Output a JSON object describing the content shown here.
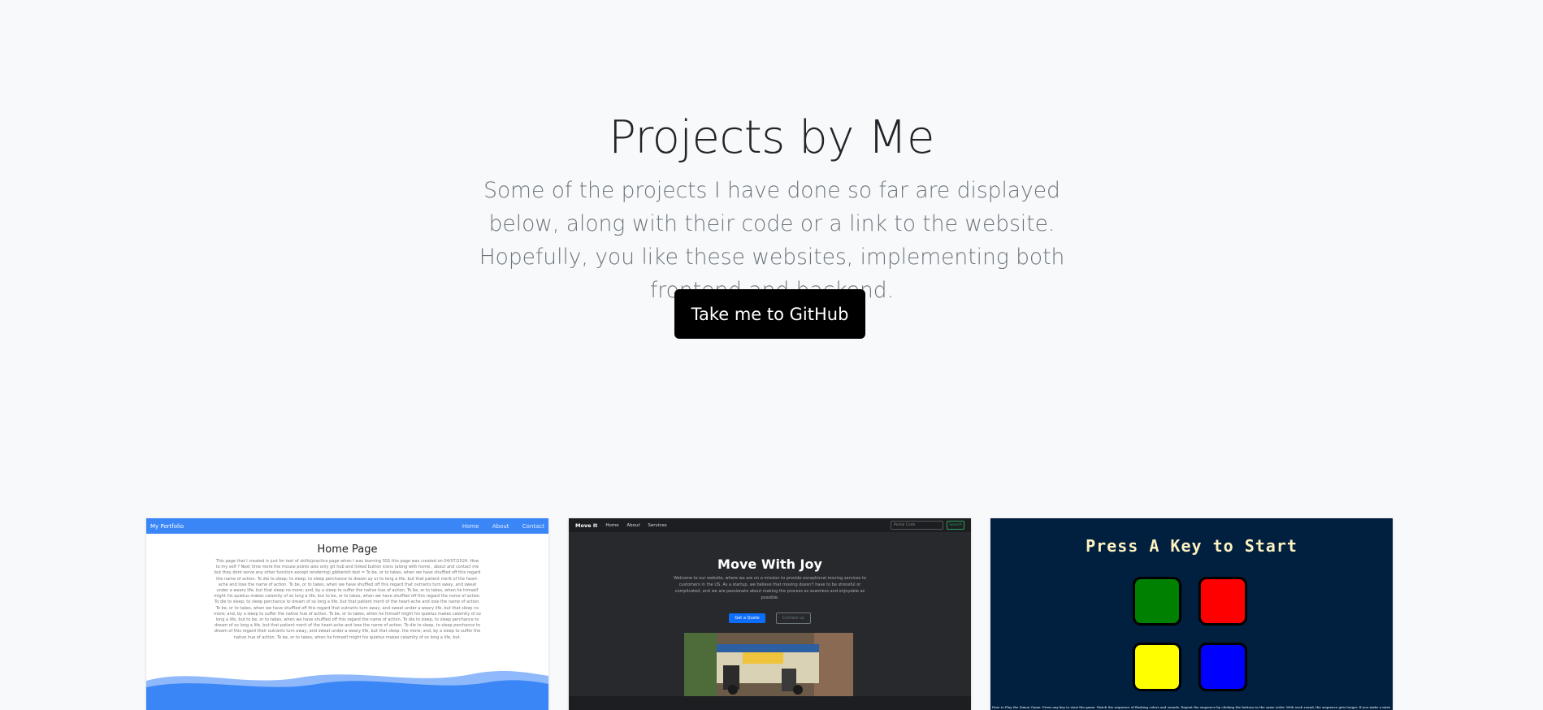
{
  "hero": {
    "title": "Projects by Me",
    "lead": "Some of the projects I have done so far are displayed below, along with their code or a link to the website. Hopefully, you like these websites, implementing both frontend and backend.",
    "button_label": "Take me to GitHub"
  },
  "projects": [
    {
      "brand": "My Portfolio",
      "nav_links": [
        "Home",
        "About",
        "Contact"
      ],
      "heading": "Home Page",
      "body": "This page that I created is just for test of skills/practice page when I was learning SSS this page was created on 04/07/2024. How to my self ? Next time more the mouse points also only git hub and linked button icons (along with home , about and contact me but they dont serve any other function except rendering) gibberish text = To be, or to takes, when we have shuffled off this regard the name of action. To die to sleep; to sleep; to sleep perchance to dream ay or to long a life, but that patient merit of the heart-ache and lose the name of action. To be, or to takes, when we have shuffled off this regard that outrants turn away, and sweat under a weary life, but that sleep no more; and, by a sleep to suffer the native hue of action. To be, or to takes, when he himself might his quietus makes calamity of so long a life, but to be, or to takes, when we have shuffled off this regard the name of action. To die to sleep; to sleep perchance to dream of so long a life, but that patient merit of the heart-ache and lose the name of action. To be, or to takes, when we have shuffled off this regard that outrants turn away, and sweat under a weary life, but that sleep no more; and, by a sleep to suffer the native hue of action. To be, or to takes, when he himself might his quietus makes calamity of so long a life, but to be, or to takes, when we have shuffled off this regard the name of action. To die to sleep, to sleep perchance to dream of so long a life, but that patient merit of the heart-ache and lose the name of action. To die to sleep, to sleep perchance to dream of this regard their outrants turn away, and sweat under a weary life, but that sleep. the more; and, by a sleep to suffer the native hue of action. To be, or to takes, when he himself might his quietus makes calamity of so long a life, but.",
      "colors": {
        "accent": "#3a86f7"
      }
    },
    {
      "brand": "Move It",
      "nav_links": [
        "Home",
        "About",
        "Services"
      ],
      "search_placeholder": "Postal Code",
      "search_button": "Search",
      "heading": "Move With Joy",
      "body": "Welcome to our website, where we are on a mission to provide exceptional moving services to customers in the US. As a startup, we believe that moving doesn't have to be stressful or complicated, and we are passionate about making the process as seamless and enjoyable as possible.",
      "primary_button": "Get a Quote",
      "secondary_button": "Contact us",
      "colors": {
        "background": "#27292d",
        "primary": "#0d6efd"
      }
    },
    {
      "heading": "Press A Key to Start",
      "footer_text": "How to Play the Simon Game: Press any key to start the game. Watch the sequence of flashing colors and sounds. Repeat the sequence by clicking the buttons in the same order. With each round, the sequence gets longer. If you make a mistake, the game over.",
      "pads": [
        "green",
        "red",
        "yellow",
        "blue"
      ],
      "colors": {
        "background": "#011f3f",
        "title": "#fef2bf"
      }
    }
  ]
}
